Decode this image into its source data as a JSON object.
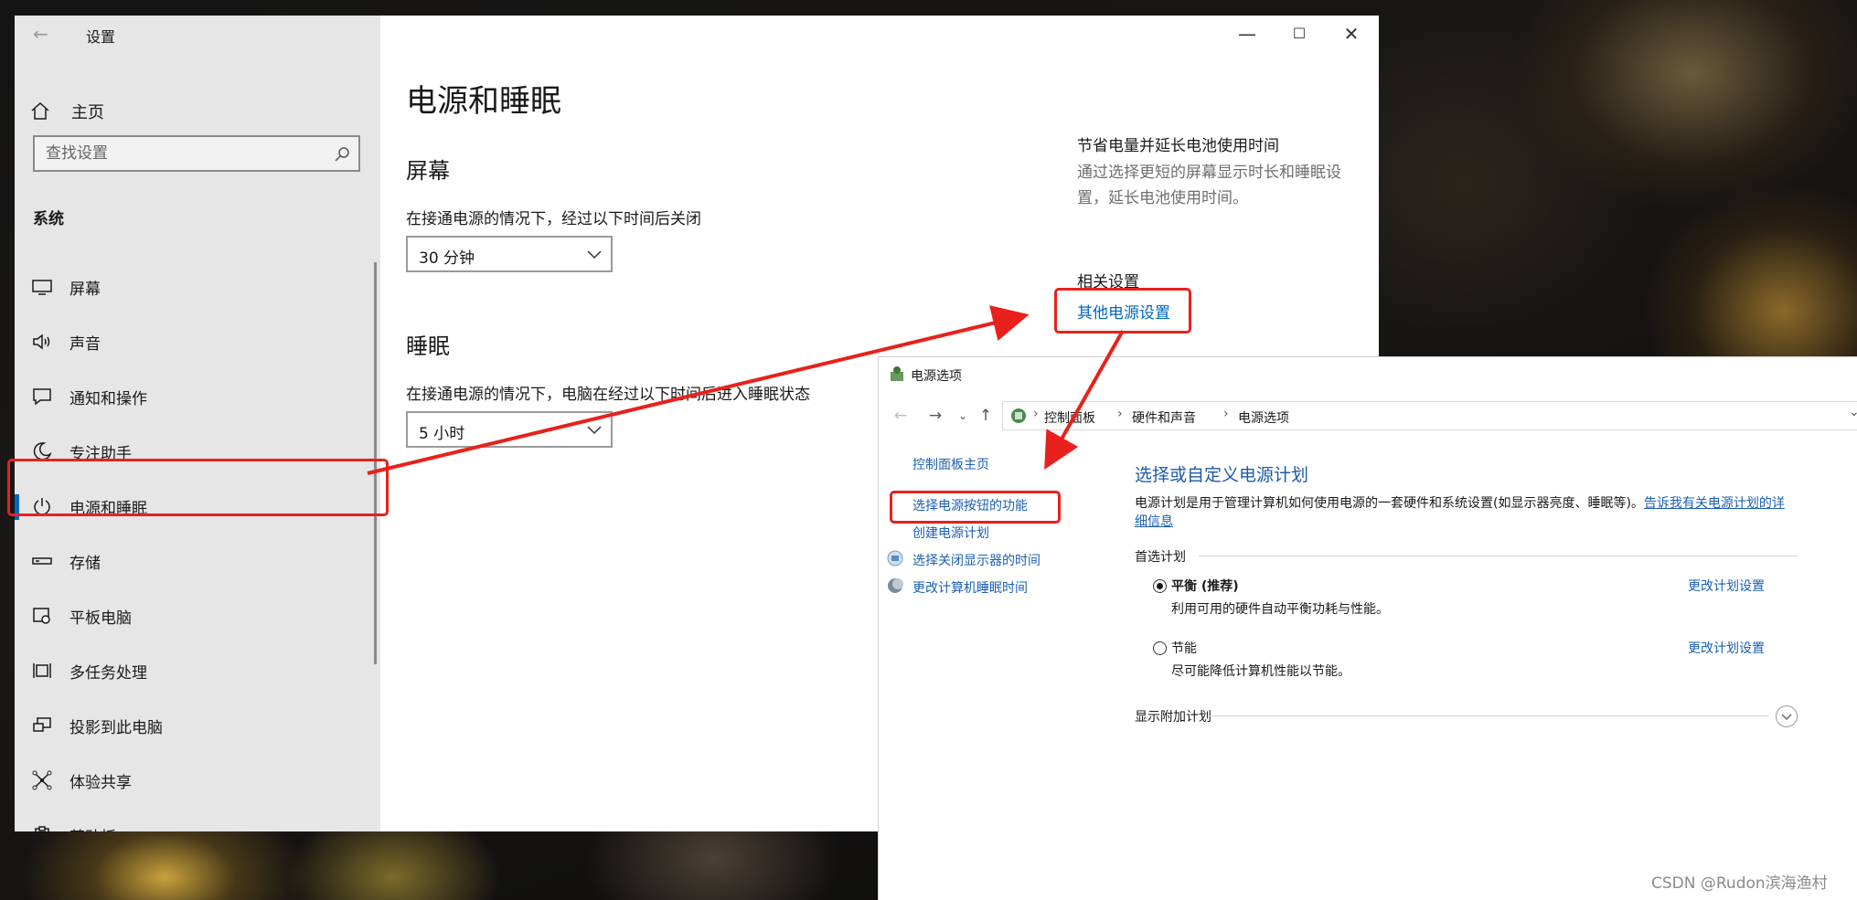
{
  "settings": {
    "title": "设置",
    "home_label": "主页",
    "search_placeholder": "查找设置",
    "group_label": "系统",
    "nav_items": [
      {
        "label": "屏幕",
        "icon": "monitor-icon"
      },
      {
        "label": "声音",
        "icon": "speaker-icon"
      },
      {
        "label": "通知和操作",
        "icon": "notification-icon"
      },
      {
        "label": "专注助手",
        "icon": "moon-icon"
      },
      {
        "label": "电源和睡眠",
        "icon": "power-icon",
        "active": true
      },
      {
        "label": "存储",
        "icon": "storage-icon"
      },
      {
        "label": "平板电脑",
        "icon": "tablet-icon"
      },
      {
        "label": "多任务处理",
        "icon": "multitask-icon"
      },
      {
        "label": "投影到此电脑",
        "icon": "project-icon"
      },
      {
        "label": "体验共享",
        "icon": "share-icon"
      },
      {
        "label": "剪贴板",
        "icon": "clipboard-icon"
      }
    ],
    "page_title": "电源和睡眠",
    "screen_section": {
      "heading": "屏幕",
      "desc": "在接通电源的情况下，经过以下时间后关闭",
      "value": "30 分钟"
    },
    "sleep_section": {
      "heading": "睡眠",
      "desc": "在接通电源的情况下，电脑在经过以下时间后进入睡眠状态",
      "value": "5 小时"
    },
    "right_panel": {
      "tip_title": "节省电量并延长电池使用时间",
      "tip_desc": "通过选择更短的屏幕显示时长和睡眠设置，延长电池使用时间。",
      "related_title": "相关设置",
      "related_link": "其他电源设置"
    }
  },
  "power_options": {
    "title": "电源选项",
    "breadcrumb": [
      "控制面板",
      "硬件和声音",
      "电源选项"
    ],
    "left_links": {
      "home": "控制面板主页",
      "power_button": "选择电源按钮的功能",
      "create_plan": "创建电源计划",
      "display_off": "选择关闭显示器的时间",
      "sleep_time": "更改计算机睡眠时间"
    },
    "heading": "选择或自定义电源计划",
    "desc": "电源计划是用于管理计算机如何使用电源的一套硬件和系统设置(如显示器亮度、睡眠等)。",
    "desc_link": "告诉我有关电源计划的详细信息",
    "preferred_label": "首选计划",
    "plans": [
      {
        "name": "平衡 (推荐)",
        "desc": "利用可用的硬件自动平衡功耗与性能。",
        "link": "更改计划设置",
        "selected": true
      },
      {
        "name": "节能",
        "desc": "尽可能降低计算机性能以节能。",
        "link": "更改计划设置",
        "selected": false
      }
    ],
    "extra_label": "显示附加计划"
  },
  "watermark": "CSDN @Rudon滨海渔村",
  "annotation_color": "#e8211c",
  "accent_color": "#0067c0"
}
